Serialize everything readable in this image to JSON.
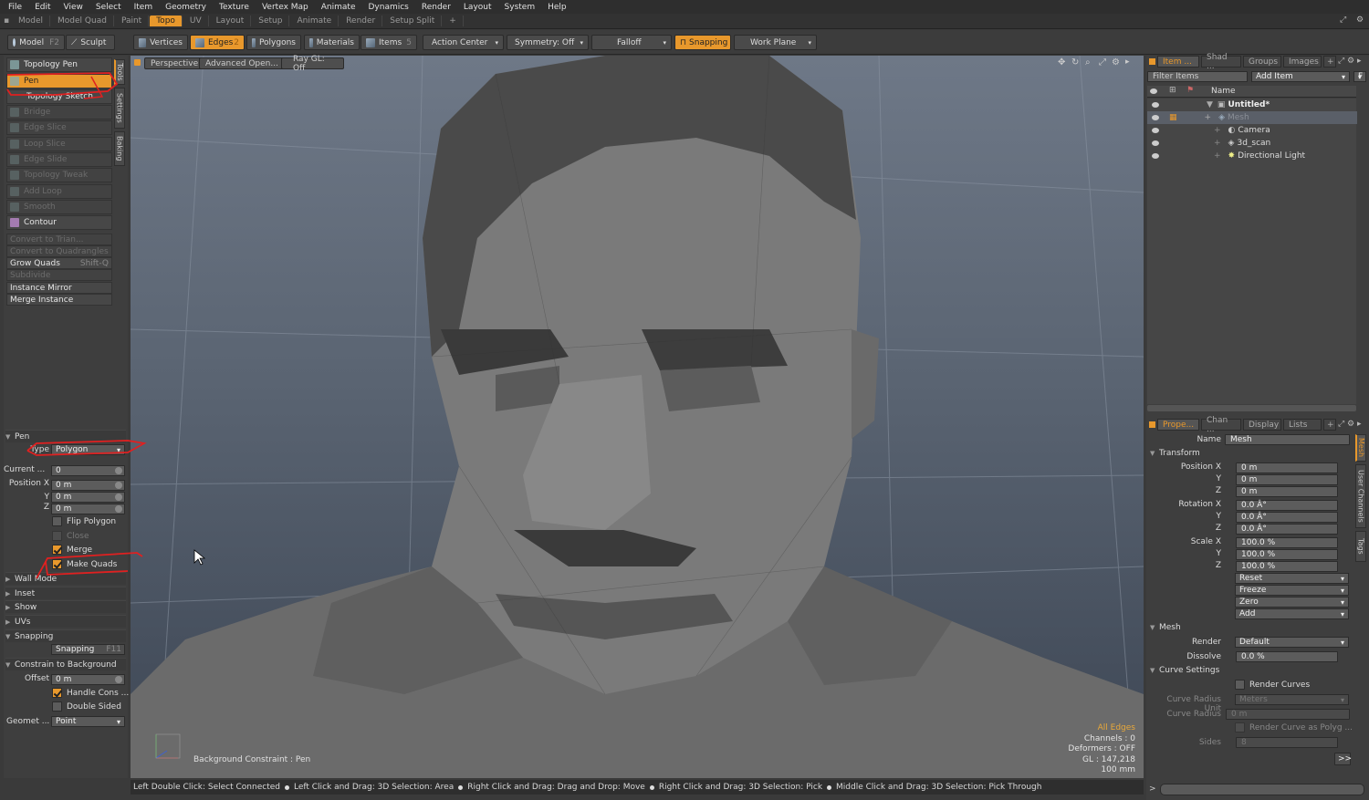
{
  "menu": [
    "File",
    "Edit",
    "View",
    "Select",
    "Item",
    "Geometry",
    "Texture",
    "Vertex Map",
    "Animate",
    "Dynamics",
    "Render",
    "Layout",
    "System",
    "Help"
  ],
  "layout_tabs": [
    "Model",
    "Model Quad",
    "Paint",
    "Topo",
    "UV",
    "Layout",
    "Setup",
    "Animate",
    "Render",
    "Setup Split",
    "+"
  ],
  "active_layout_tab": "Topo",
  "toolbar": {
    "model": "Model",
    "model_key": "F2",
    "sculpt": "Sculpt",
    "vertices": "Vertices",
    "edges": "Edges",
    "edges_key": "2",
    "polygons": "Polygons",
    "materials": "Materials",
    "items": "Items",
    "items_key": "5",
    "action_center": "Action Center",
    "symmetry": "Symmetry: Off",
    "falloff": "Falloff",
    "snapping": "Snapping",
    "work_plane": "Work Plane"
  },
  "tools": {
    "topology_pen": "Topology Pen",
    "pen": "Pen",
    "topology_sketch": "Topology Sketch",
    "bridge": "Bridge",
    "edge_slice": "Edge Slice",
    "loop_slice": "Loop Slice",
    "edge_slide": "Edge Slide",
    "topology_tweak": "Topology Tweak",
    "add_loop": "Add Loop",
    "smooth": "Smooth",
    "contour": "Contour",
    "convert_tri": "Convert to Trian...",
    "convert_quad": "Convert to Quadrangles",
    "grow_quads": "Grow Quads",
    "grow_quads_key": "Shift-Q",
    "subdivide": "Subdivide",
    "instance_mirror": "Instance Mirror",
    "merge_instance": "Merge Instance"
  },
  "side_tabs": [
    "Tools",
    "Settings",
    "Baking"
  ],
  "pen_props": {
    "header": "Pen",
    "type_label": "Type",
    "type_value": "Polygon",
    "current_label": "Current ...",
    "current_value": "0",
    "position_x_label": "Position X",
    "y_label": "Y",
    "z_label": "Z",
    "pos_x": "0 m",
    "pos_y": "0 m",
    "pos_z": "0 m",
    "flip_polygon": "Flip Polygon",
    "close": "Close",
    "merge": "Merge",
    "make_quads": "Make Quads",
    "wall_mode": "Wall Mode",
    "inset": "Inset",
    "show": "Show",
    "uvs": "UVs",
    "snapping": "Snapping",
    "snapping_btn": "Snapping",
    "snapping_key": "F11",
    "constrain": "Constrain to Background",
    "offset_label": "Offset",
    "offset_value": "0 m",
    "handle_cons": "Handle Cons ...",
    "double_sided": "Double Sided",
    "geomet_label": "Geomet ...",
    "geomet_value": "Point"
  },
  "viewport": {
    "perspective": "Perspective",
    "advanced": "Advanced Open...",
    "raygl": "Ray GL: Off",
    "bg_constraint": "Background Constraint",
    "pen_label": ": Pen",
    "all_edges": "All Edges",
    "channels": "Channels : 0",
    "deformers": "Deformers : OFF",
    "gl": "GL : 147,218",
    "size": "100 mm"
  },
  "status": [
    "Left Double Click: Select Connected",
    "Left Click and Drag: 3D Selection: Area",
    "Right Click and Drag: Drag and Drop: Move",
    "Right Click and Drag: 3D Selection: Pick",
    "Middle Click and Drag: 3D Selection: Pick Through"
  ],
  "item_list": {
    "tabs": [
      "Item ...",
      "Shad ...",
      "Groups",
      "Images",
      "+"
    ],
    "filter_placeholder": "Filter Items",
    "add_item": "Add Item",
    "f_btn": "F",
    "name_col": "Name",
    "items": [
      "Untitled*",
      "Mesh",
      "Camera",
      "3d_scan",
      "Directional Light"
    ]
  },
  "properties": {
    "tabs": [
      "Prope...",
      "Chan ...",
      "Display",
      "Lists",
      "+"
    ],
    "name_label": "Name",
    "name_value": "Mesh",
    "transform": "Transform",
    "position_x": "Position X",
    "rotation_x": "Rotation X",
    "scale_x": "Scale X",
    "y": "Y",
    "z": "Z",
    "pos": [
      "0 m",
      "0 m",
      "0 m"
    ],
    "rot": [
      "0.0 Â°",
      "0.0 Â°",
      "0.0 Â°"
    ],
    "scl": [
      "100.0 %",
      "100.0 %",
      "100.0 %"
    ],
    "reset": "Reset",
    "freeze": "Freeze",
    "zero": "Zero",
    "add": "Add",
    "mesh": "Mesh",
    "render_label": "Render",
    "render_value": "Default",
    "dissolve_label": "Dissolve",
    "dissolve_value": "0.0 %",
    "curve_settings": "Curve Settings",
    "render_curves": "Render Curves",
    "curve_radius_unit": "Curve Radius Unit",
    "curve_radius_unit_value": "Meters",
    "curve_radius": "Curve Radius",
    "curve_radius_value": "0 m",
    "render_curve_poly": "Render Curve as Polyg ...",
    "sides": "Sides",
    "sides_value": "8",
    "more": ">>",
    "side_tabs": [
      "Mesh",
      "User Channels",
      "Tags"
    ]
  },
  "colors": {
    "accent": "#e8982c",
    "annotation": "#e02020"
  }
}
